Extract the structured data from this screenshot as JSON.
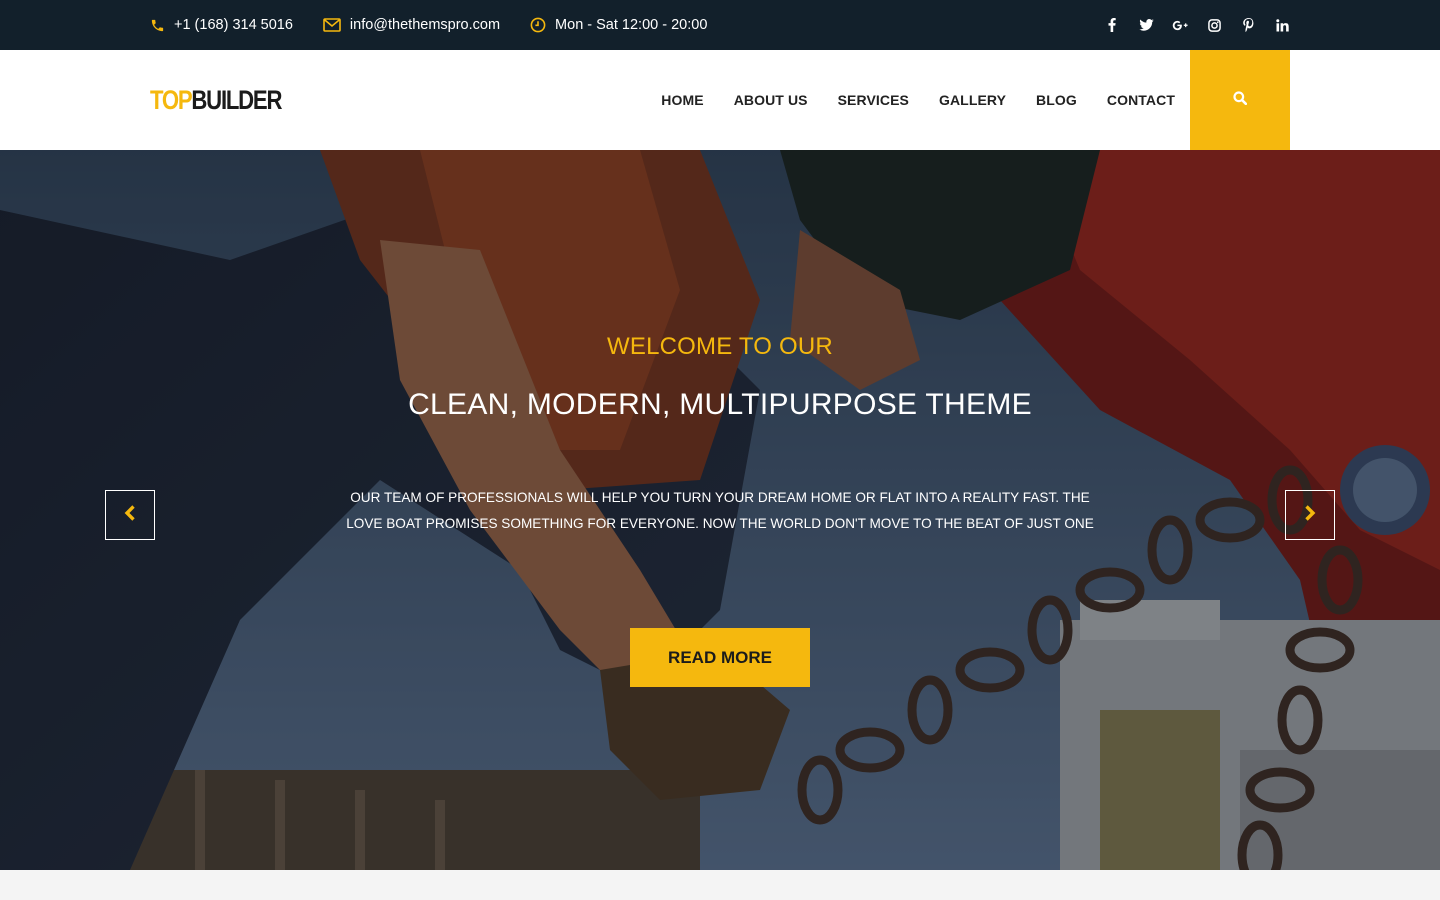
{
  "colors": {
    "accent": "#f5b80e",
    "topbar_bg": "#12202b",
    "header_bg": "#ffffff",
    "text_dark": "#222222"
  },
  "topbar": {
    "phone": {
      "icon": "phone-icon",
      "text": "+1 (168) 314 5016"
    },
    "email": {
      "icon": "envelope-icon",
      "text": "info@thethemspro.com"
    },
    "hours": {
      "icon": "clock-icon",
      "text": "Mon - Sat 12:00 - 20:00"
    },
    "socials": [
      "facebook-icon",
      "twitter-icon",
      "google-plus-icon",
      "instagram-icon",
      "pinterest-icon",
      "linkedin-icon"
    ]
  },
  "header": {
    "logo_part1": "TOP",
    "logo_part2": "BUILDER",
    "nav": [
      "HOME",
      "ABOUT US",
      "SERVICES",
      "GALLERY",
      "BLOG",
      "CONTACT"
    ],
    "search_icon": "search-icon"
  },
  "hero": {
    "subtitle": "WELCOME TO OUR",
    "title": "CLEAN, MODERN, MULTIPURPOSE THEME",
    "text": "OUR TEAM OF PROFESSIONALS WILL HELP YOU TURN YOUR DREAM HOME OR FLAT INTO A REALITY FAST. THE LOVE BOAT PROMISES SOMETHING FOR EVERYONE. NOW THE WORLD DON'T MOVE TO THE BEAT OF JUST ONE",
    "button": "READ MORE",
    "prev_icon": "chevron-left-icon",
    "next_icon": "chevron-right-icon"
  }
}
